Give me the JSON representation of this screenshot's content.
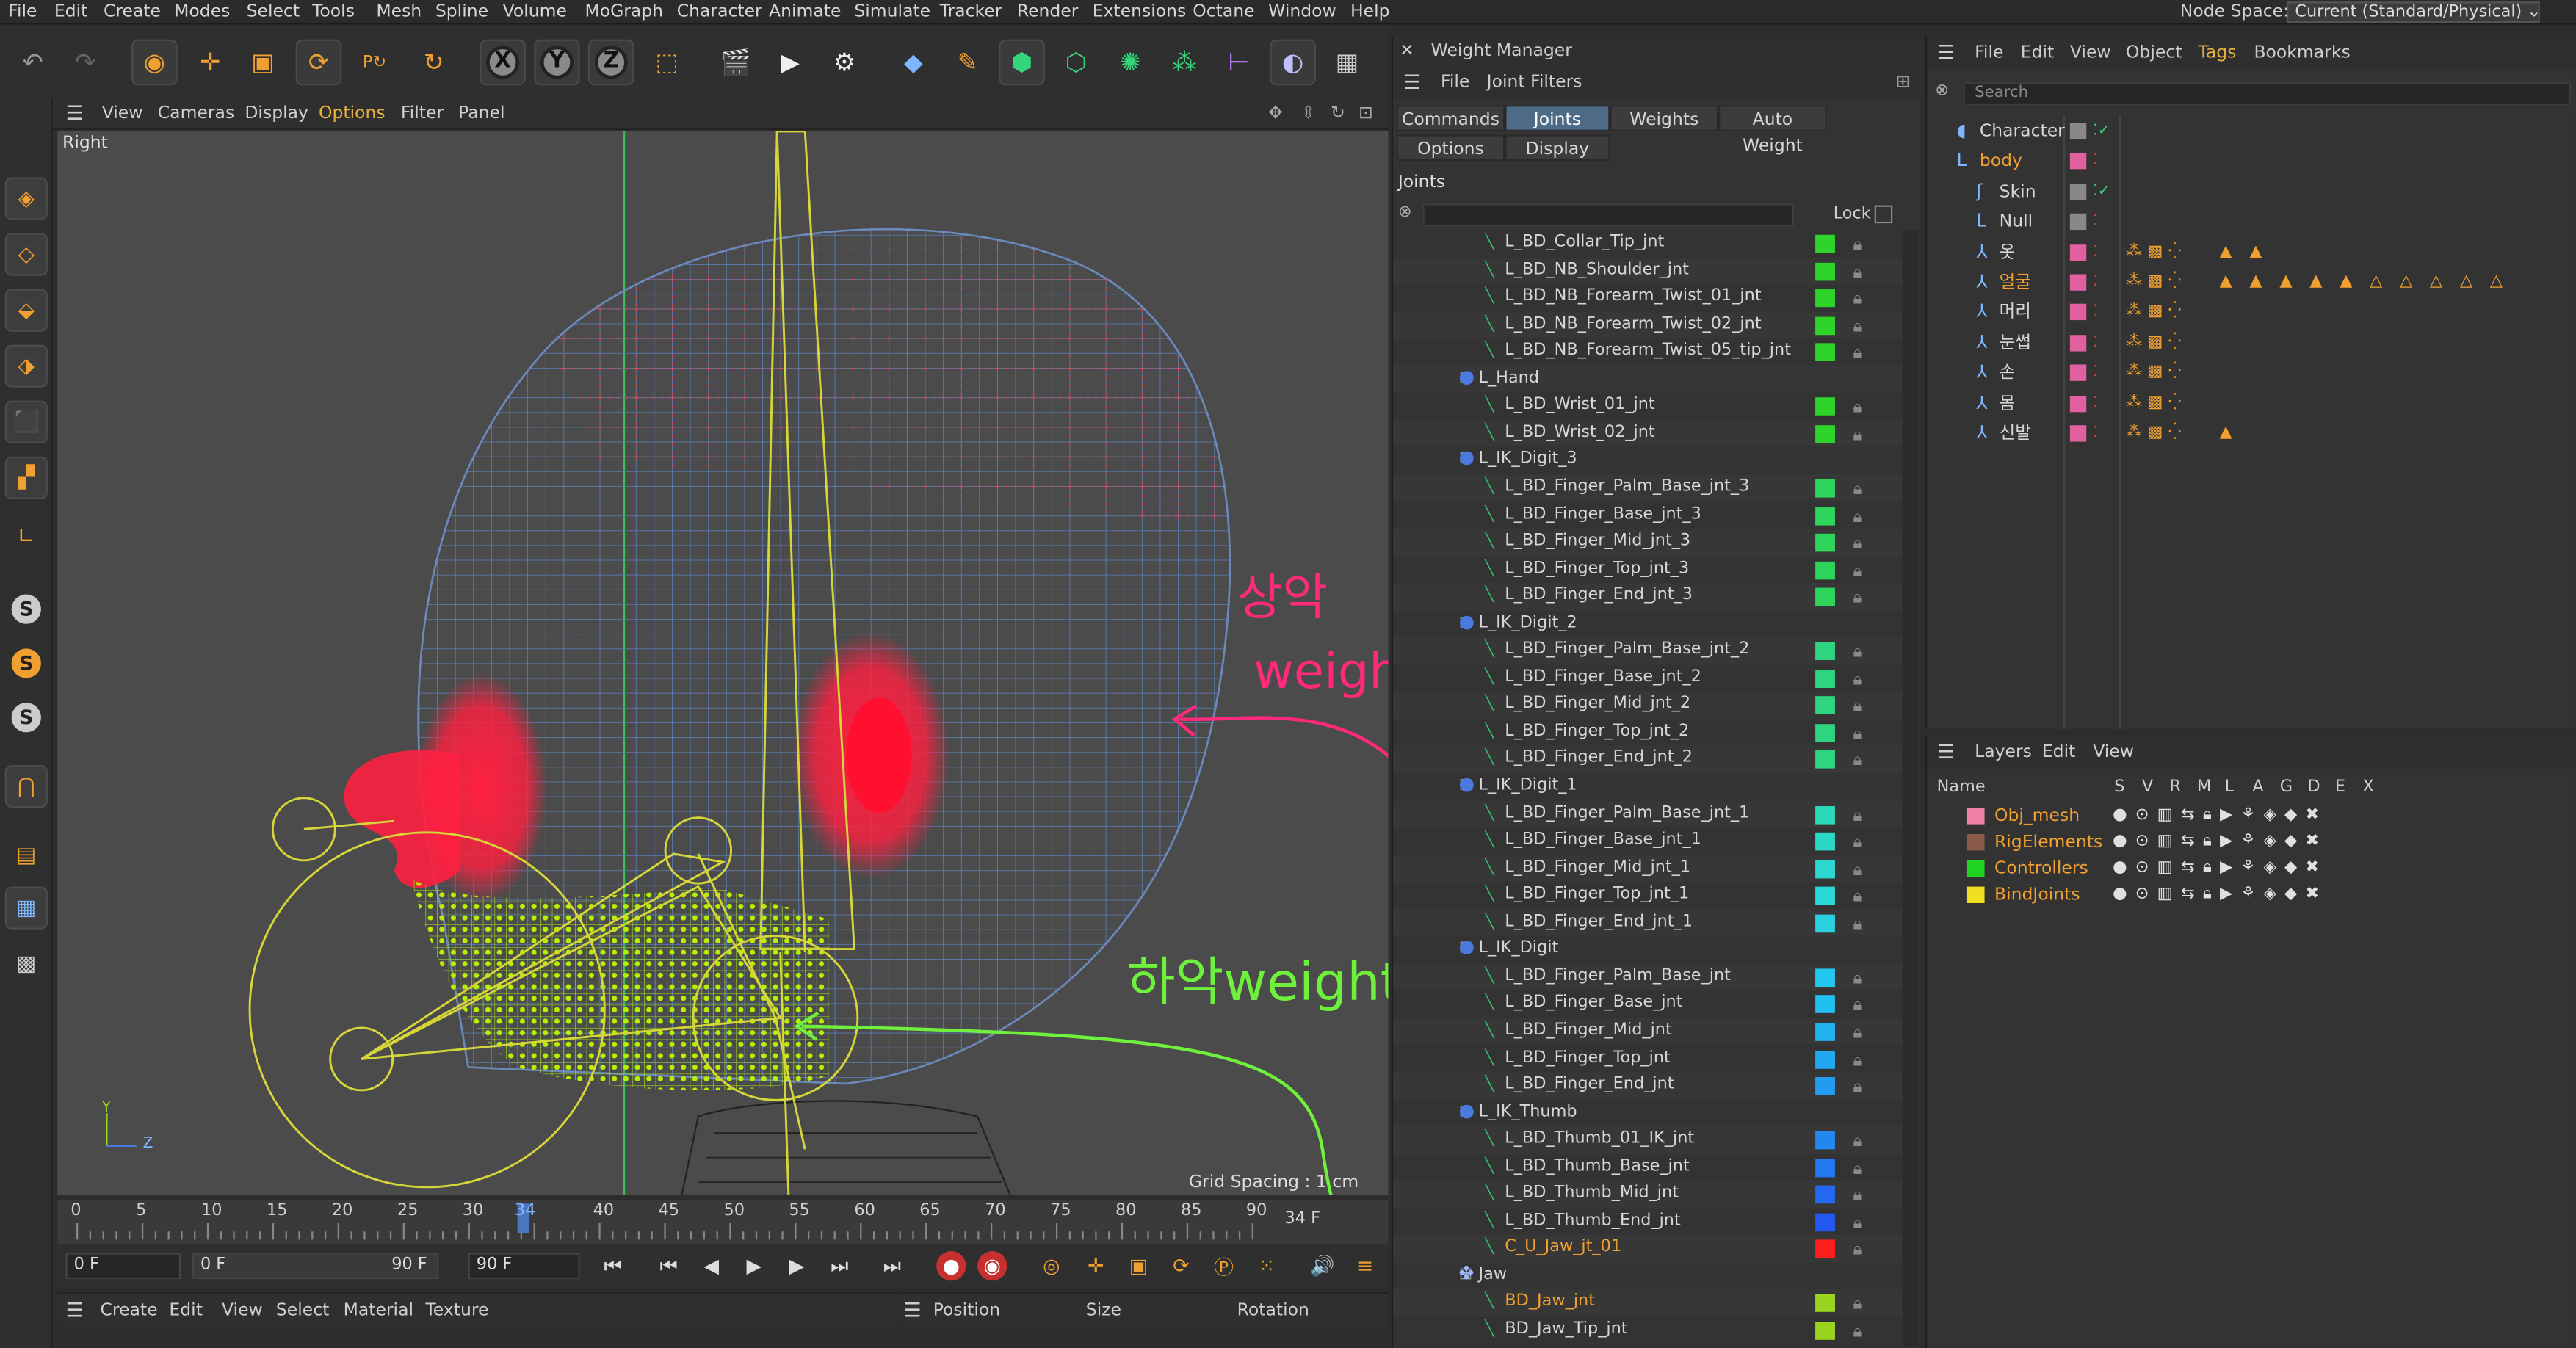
{
  "menubar": {
    "items": [
      "File",
      "Edit",
      "Create",
      "Modes",
      "Select",
      "Tools",
      "Mesh",
      "Spline",
      "Volume",
      "MoGraph",
      "Character",
      "Animate",
      "Simulate",
      "Tracker",
      "Render",
      "Extensions",
      "Octane",
      "Window",
      "Help"
    ],
    "node_space_label": "Node Space:",
    "node_space_value": "Current (Standard/Physical)"
  },
  "viewport": {
    "menu": [
      "View",
      "Cameras",
      "Display",
      "Options",
      "Filter",
      "Panel"
    ],
    "active_menu": "Options",
    "label": "Right",
    "grid_spacing": "Grid Spacing : 1 cm",
    "axis_y": "Y",
    "axis_z": "Z"
  },
  "annotations": {
    "upper_jaw": "상악 weights",
    "upper_jaw_line1": "상악",
    "upper_jaw_line2": "weights",
    "lower_jaw": "하악weights",
    "upper_color": "#ff2a7a",
    "lower_color": "#6ef03c"
  },
  "timeline": {
    "ticks": [
      "0",
      "5",
      "10",
      "15",
      "20",
      "25",
      "30",
      "34",
      "40",
      "45",
      "50",
      "55",
      "60",
      "65",
      "70",
      "75",
      "80",
      "85",
      "90"
    ],
    "current_frame": "34 F",
    "current_tick": "34",
    "start_field": "0 F",
    "range_start": "0 F",
    "range_end": "90 F",
    "end_field": "90 F"
  },
  "material_bar": [
    "Create",
    "Edit",
    "View",
    "Select",
    "Material",
    "Texture"
  ],
  "attribute_bar": [
    "Position",
    "Size",
    "Rotation"
  ],
  "weight_manager": {
    "title": "Weight Manager",
    "menu": [
      "File",
      "Joint Filters"
    ],
    "tabs_row1": [
      "Commands",
      "Joints",
      "Weights",
      "Auto Weight"
    ],
    "active_tab": "Joints",
    "tabs_row2": [
      "Options",
      "Display"
    ],
    "joints_header": "Joints",
    "lock_label": "Lock",
    "joints": [
      {
        "name": "L_BD_Collar_Tip_jnt",
        "type": "joint",
        "color": "#2fd42a"
      },
      {
        "name": "L_BD_NB_Shoulder_jnt",
        "type": "joint",
        "color": "#2fd42a"
      },
      {
        "name": "L_BD_NB_Forearm_Twist_01_jnt",
        "type": "joint",
        "color": "#2fd42a"
      },
      {
        "name": "L_BD_NB_Forearm_Twist_02_jnt",
        "type": "joint",
        "color": "#2fd42a"
      },
      {
        "name": "L_BD_NB_Forearm_Twist_05_tip_jnt",
        "type": "joint",
        "color": "#2fd42a"
      },
      {
        "name": "L_Hand",
        "type": "group",
        "color": ""
      },
      {
        "name": "L_BD_Wrist_01_jnt",
        "type": "joint",
        "color": "#2fd42a"
      },
      {
        "name": "L_BD_Wrist_02_jnt",
        "type": "joint",
        "color": "#2fd42a"
      },
      {
        "name": "L_IK_Digit_3",
        "type": "group",
        "color": ""
      },
      {
        "name": "L_BD_Finger_Palm_Base_jnt_3",
        "type": "joint",
        "color": "#2fd45a"
      },
      {
        "name": "L_BD_Finger_Base_jnt_3",
        "type": "joint",
        "color": "#2fd45a"
      },
      {
        "name": "L_BD_Finger_Mid_jnt_3",
        "type": "joint",
        "color": "#2fd45a"
      },
      {
        "name": "L_BD_Finger_Top_jnt_3",
        "type": "joint",
        "color": "#2fd45a"
      },
      {
        "name": "L_BD_Finger_End_jnt_3",
        "type": "joint",
        "color": "#2fd45a"
      },
      {
        "name": "L_IK_Digit_2",
        "type": "group",
        "color": ""
      },
      {
        "name": "L_BD_Finger_Palm_Base_jnt_2",
        "type": "joint",
        "color": "#2fd480"
      },
      {
        "name": "L_BD_Finger_Base_jnt_2",
        "type": "joint",
        "color": "#2fd480"
      },
      {
        "name": "L_BD_Finger_Mid_jnt_2",
        "type": "joint",
        "color": "#2fd480"
      },
      {
        "name": "L_BD_Finger_Top_jnt_2",
        "type": "joint",
        "color": "#2fd480"
      },
      {
        "name": "L_BD_Finger_End_jnt_2",
        "type": "joint",
        "color": "#2fd480"
      },
      {
        "name": "L_IK_Digit_1",
        "type": "group",
        "color": ""
      },
      {
        "name": "L_BD_Finger_Palm_Base_jnt_1",
        "type": "joint",
        "color": "#2ad8b8"
      },
      {
        "name": "L_BD_Finger_Base_jnt_1",
        "type": "joint",
        "color": "#2ad8c8"
      },
      {
        "name": "L_BD_Finger_Mid_jnt_1",
        "type": "joint",
        "color": "#2ad8d0"
      },
      {
        "name": "L_BD_Finger_Top_jnt_1",
        "type": "joint",
        "color": "#2ad8d8"
      },
      {
        "name": "L_BD_Finger_End_jnt_1",
        "type": "joint",
        "color": "#2ad0e0"
      },
      {
        "name": "L_IK_Digit",
        "type": "group",
        "color": ""
      },
      {
        "name": "L_BD_Finger_Palm_Base_jnt",
        "type": "joint",
        "color": "#22c8f0"
      },
      {
        "name": "L_BD_Finger_Base_jnt",
        "type": "joint",
        "color": "#22c0f0"
      },
      {
        "name": "L_BD_Finger_Mid_jnt",
        "type": "joint",
        "color": "#22b4f0"
      },
      {
        "name": "L_BD_Finger_Top_jnt",
        "type": "joint",
        "color": "#22a8f0"
      },
      {
        "name": "L_BD_Finger_End_jnt",
        "type": "joint",
        "color": "#229cf0"
      },
      {
        "name": "L_IK_Thumb",
        "type": "group",
        "color": ""
      },
      {
        "name": "L_BD_Thumb_01_IK_jnt",
        "type": "joint",
        "color": "#2288f0"
      },
      {
        "name": "L_BD_Thumb_Base_jnt",
        "type": "joint",
        "color": "#2278f0"
      },
      {
        "name": "L_BD_Thumb_Mid_jnt",
        "type": "joint",
        "color": "#2268f0"
      },
      {
        "name": "L_BD_Thumb_End_jnt",
        "type": "joint",
        "color": "#2258f0"
      },
      {
        "name": "C_U_Jaw_jt_01",
        "type": "joint-orange",
        "color": "#ff1e1e"
      },
      {
        "name": "Jaw",
        "type": "group-jaw",
        "color": ""
      },
      {
        "name": "BD_Jaw_jnt",
        "type": "joint-orange",
        "color": "#9ad41e"
      },
      {
        "name": "BD_Jaw_Tip_jnt",
        "type": "joint",
        "color": "#9ad41e"
      }
    ]
  },
  "object_manager": {
    "menu": [
      "File",
      "Edit",
      "View",
      "Object",
      "Tags",
      "Bookmarks"
    ],
    "active_menu": "Tags",
    "search_placeholder": "Search",
    "objects": [
      {
        "name": "Character",
        "color": "#d6d6d6",
        "icon": "character-icon",
        "check": "✓",
        "triangles": 0
      },
      {
        "name": "body",
        "color": "#f0a030",
        "icon": "null-icon",
        "check": "",
        "triangles": 0
      },
      {
        "name": "Skin",
        "color": "#d6d6d6",
        "icon": "skin-icon",
        "check": "✓",
        "triangles": 0
      },
      {
        "name": "Null",
        "color": "#d6d6d6",
        "icon": "null-icon",
        "check": "",
        "triangles": 0
      },
      {
        "name": "옷",
        "color": "#d6d6d6",
        "icon": "mesh-icon",
        "check": "",
        "triangles": 2
      },
      {
        "name": "얼굴",
        "color": "#f0a030",
        "icon": "mesh-icon",
        "check": "",
        "triangles": 10
      },
      {
        "name": "머리",
        "color": "#d6d6d6",
        "icon": "mesh-icon",
        "check": "",
        "triangles": 0
      },
      {
        "name": "눈썹",
        "color": "#d6d6d6",
        "icon": "mesh-icon",
        "check": "",
        "triangles": 0
      },
      {
        "name": "손",
        "color": "#d6d6d6",
        "icon": "mesh-icon",
        "check": "",
        "triangles": 0
      },
      {
        "name": "몸",
        "color": "#d6d6d6",
        "icon": "mesh-icon",
        "check": "",
        "triangles": 0
      },
      {
        "name": "신발",
        "color": "#d6d6d6",
        "icon": "mesh-icon",
        "check": "",
        "triangles": 1
      }
    ]
  },
  "layers": {
    "menu": [
      "Layers",
      "Edit",
      "View"
    ],
    "header_name": "Name",
    "header_cols": [
      "S",
      "V",
      "R",
      "M",
      "L",
      "A",
      "G",
      "D",
      "E",
      "X"
    ],
    "items": [
      {
        "name": "Obj_mesh",
        "color": "#f07fa8"
      },
      {
        "name": "RigElements",
        "color": "#8a5a4a"
      },
      {
        "name": "Controllers",
        "color": "#22d422"
      },
      {
        "name": "BindJoints",
        "color": "#f0e022"
      }
    ]
  }
}
